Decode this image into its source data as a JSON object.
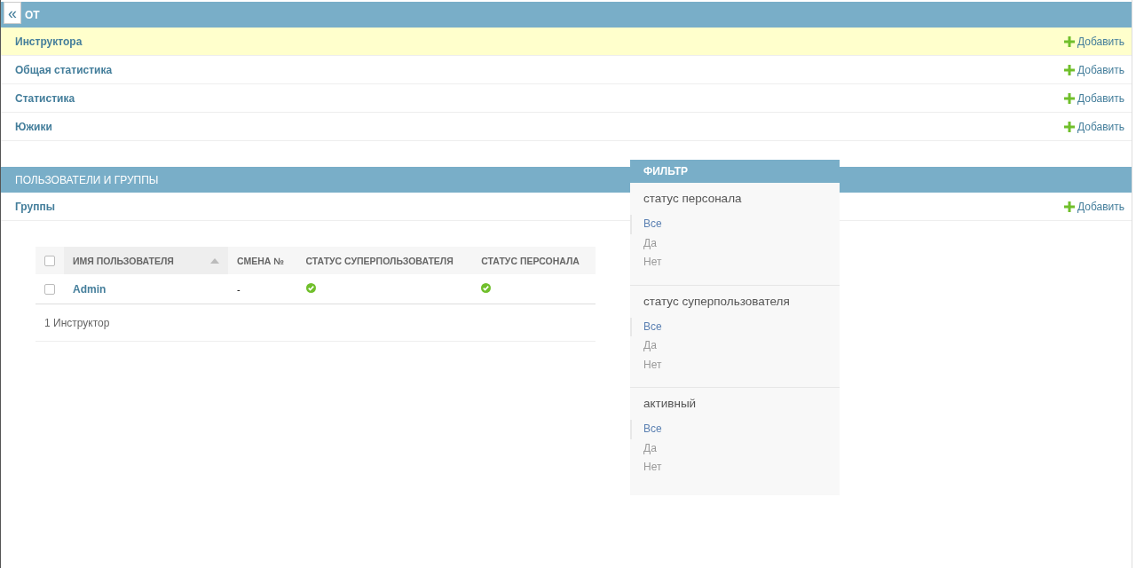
{
  "sidebar_toggle": {
    "label": "«"
  },
  "sections": [
    {
      "title": "ОТ",
      "items": [
        {
          "label": "Инструктора",
          "selected": true,
          "action": "Добавить"
        },
        {
          "label": "Общая статистика",
          "selected": false,
          "action": "Добавить"
        },
        {
          "label": "Статистика",
          "selected": false,
          "action": "Добавить"
        },
        {
          "label": "Южики",
          "selected": false,
          "action": "Добавить"
        }
      ]
    },
    {
      "title": "ПОЛЬЗОВАТЕЛИ И ГРУППЫ",
      "items": [
        {
          "label": "Группы",
          "selected": false,
          "action": "Добавить"
        }
      ]
    }
  ],
  "table": {
    "select_all": {
      "checked": false
    },
    "columns": [
      {
        "label": "ИМЯ ПОЛЬЗОВАТЕЛЯ",
        "sorted": true
      },
      {
        "label": "СМЕНА №",
        "sorted": false
      },
      {
        "label": "СТАТУС СУПЕРПОЛЬЗОВАТЕЛЯ",
        "sorted": false
      },
      {
        "label": "СТАТУС ПЕРСОНАЛА",
        "sorted": false
      }
    ],
    "rows": [
      {
        "checked": false,
        "username": "Admin",
        "shift": "-",
        "superuser": true,
        "staff": true
      }
    ],
    "footer": "1 Инструктор"
  },
  "filter": {
    "title": "ФИЛЬТР",
    "groups": [
      {
        "title": "статус персонала",
        "choices": [
          {
            "label": "Все",
            "selected": true
          },
          {
            "label": "Да",
            "selected": false
          },
          {
            "label": "Нет",
            "selected": false
          }
        ]
      },
      {
        "title": "статус суперпользователя",
        "choices": [
          {
            "label": "Все",
            "selected": true
          },
          {
            "label": "Да",
            "selected": false
          },
          {
            "label": "Нет",
            "selected": false
          }
        ]
      },
      {
        "title": "активный",
        "choices": [
          {
            "label": "Все",
            "selected": true
          },
          {
            "label": "Да",
            "selected": false
          },
          {
            "label": "Нет",
            "selected": false
          }
        ]
      }
    ]
  }
}
